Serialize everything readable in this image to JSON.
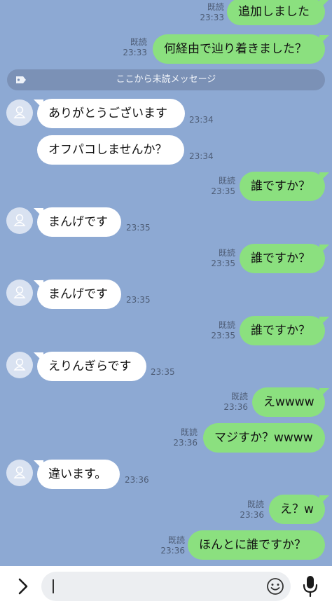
{
  "unread_divider": "ここから未読メッセージ",
  "read_label": "既読",
  "messages": [
    {
      "side": "out",
      "text": "追加しました",
      "time": "23:33"
    },
    {
      "side": "out",
      "text": "何経由で辿り着きました？",
      "time": "23:33"
    },
    {
      "side": "in",
      "text": "ありがとうございます",
      "time": "23:34"
    },
    {
      "side": "in",
      "text": "オフパコしませんか？",
      "time": "23:34"
    },
    {
      "side": "out",
      "text": "誰ですか？",
      "time": "23:35"
    },
    {
      "side": "in",
      "text": "まんげです",
      "time": "23:35"
    },
    {
      "side": "out",
      "text": "誰ですか？",
      "time": "23:35"
    },
    {
      "side": "in",
      "text": "まんげです",
      "time": "23:35"
    },
    {
      "side": "out",
      "text": "誰ですか？",
      "time": "23:35"
    },
    {
      "side": "in",
      "text": "えりんぎらです",
      "time": "23:35"
    },
    {
      "side": "out",
      "text": "えwwww",
      "time": "23:36"
    },
    {
      "side": "out",
      "text": "マジすか？wwww",
      "time": "23:36"
    },
    {
      "side": "in",
      "text": "違います。",
      "time": "23:36"
    },
    {
      "side": "out",
      "text": "え？w",
      "time": "23:36"
    },
    {
      "side": "out",
      "text": "ほんとに誰ですか？",
      "time": "23:36"
    }
  ],
  "icons": {
    "expand": "chevron-right-icon",
    "emoji": "smiley-icon",
    "mic": "microphone-icon",
    "tag": "tag-icon",
    "avatar": "default-user-icon"
  }
}
